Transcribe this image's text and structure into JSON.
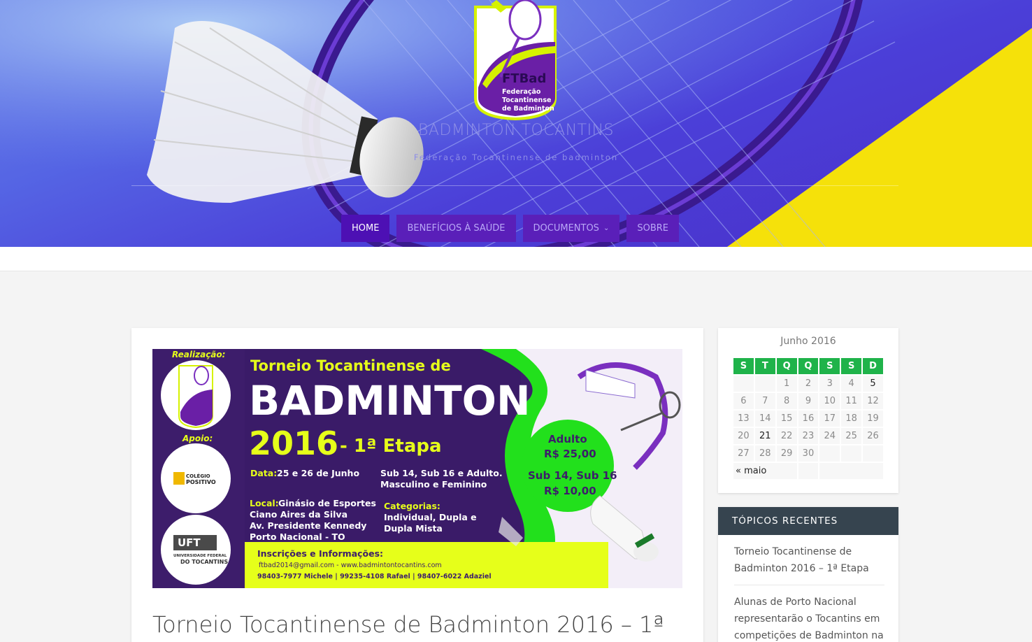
{
  "site": {
    "title": "BADMINTON TOCANTINS",
    "tagline": "Federação Tocantinense de badminton",
    "logo": {
      "letters": "FTBad",
      "line1": "Federação",
      "line2": "Tocantinense",
      "line3": "de Badminton"
    }
  },
  "nav": {
    "items": [
      {
        "label": "HOME",
        "active": true
      },
      {
        "label": "BENEFÍCIOS À SAÚDE",
        "active": false
      },
      {
        "label": "DOCUMENTOS",
        "active": false,
        "has_dropdown": true
      },
      {
        "label": "SOBRE",
        "active": false
      }
    ]
  },
  "post": {
    "title": "Torneio Tocantinense de Badminton 2016 – 1ª",
    "banner": {
      "realizacao": "Realização:",
      "apoio": "Apoio:",
      "sponsor1": "COLÉGIO",
      "sponsor1b": "POSITIVO",
      "sponsor2": "UFT",
      "sponsor2b": "UNIVERSIDADE FEDERAL",
      "sponsor2c": "DO TOCANTINS",
      "headline1": "Torneio Tocantinense de",
      "headline2": "BADMINTON",
      "headline3": "2016",
      "headline4": "- 1ª Etapa",
      "data_label": "Data:",
      "data_value": "25 e 26 de Junho",
      "divisions1": "Sub 14, Sub 16 e Adulto.",
      "divisions2": "Masculino e Feminino",
      "local_label": "Local:",
      "local1": "Ginásio de Esportes",
      "local2": "Ciano Aires da Silva",
      "local3": "Av. Presidente Kennedy",
      "local4": "Porto Nacional - TO",
      "categorias_label": "Categorias:",
      "categorias1": "Individual, Dupla e",
      "categorias2": "Dupla Mista",
      "inscricoes": "Inscrições e Informações:",
      "contact_email": "ftbad2014@gmail.com - www.badmintontocantins.com",
      "contact_phones": "98403-7977 Michele  |  99235-4108 Rafael  |  98407-6022 Adaziel",
      "price1_label": "Adulto",
      "price1_value": "R$ 25,00",
      "price2_label": "Sub 14, Sub 16",
      "price2_value": "R$ 10,00"
    }
  },
  "calendar": {
    "caption": "Junho 2016",
    "weekdays": [
      "S",
      "T",
      "Q",
      "Q",
      "S",
      "S",
      "D"
    ],
    "rows": [
      [
        "",
        "",
        "1",
        "2",
        "3",
        "4",
        "5"
      ],
      [
        "6",
        "7",
        "8",
        "9",
        "10",
        "11",
        "12"
      ],
      [
        "13",
        "14",
        "15",
        "16",
        "17",
        "18",
        "19"
      ],
      [
        "20",
        "21",
        "22",
        "23",
        "24",
        "25",
        "26"
      ],
      [
        "27",
        "28",
        "29",
        "30",
        "",
        "",
        ""
      ]
    ],
    "days_with_posts": [
      "5",
      "21"
    ],
    "prev_link": "« maio",
    "header_color": "#1fb34a"
  },
  "recent": {
    "heading": "TÓPICOS RECENTES",
    "items": [
      "Torneio Tocantinense de Badminton 2016 – 1ª Etapa",
      "Alunas de Porto Nacional representarão o Tocantins em competições de Badminton na"
    ]
  },
  "colors": {
    "nav_bg": "#5a1fb9",
    "nav_active": "#4d10b4",
    "accent_yellow": "#f5e10a",
    "banner_purple": "#3d1d6b",
    "banner_lime": "#e6ff1a",
    "banner_green": "#22e01c"
  }
}
